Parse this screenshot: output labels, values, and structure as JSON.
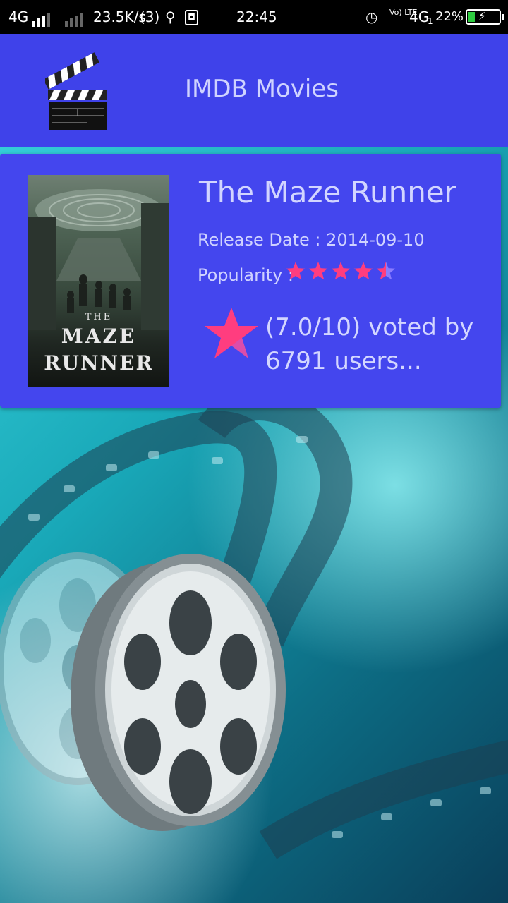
{
  "status_bar": {
    "network_left": "4G",
    "speed": "23.5K/s",
    "data_icon_text": "(3)",
    "time": "22:45",
    "volte": "Vo) LTE",
    "network_right": "4G",
    "sim_slot": "1",
    "battery": "22%"
  },
  "app": {
    "title": "IMDB Movies",
    "logo_icon": "clapperboard-icon"
  },
  "movie": {
    "title": "The Maze Runner",
    "release": "Release Date : 2014-09-10",
    "popularity_label": "Popularity :",
    "rating_stars": 4.5,
    "rating_stars_max": 5,
    "votes_text": "(7.0/10) voted by 6791 users...",
    "poster": {
      "line1": "THE",
      "line2": "MAZE",
      "line3": "RUNNER"
    }
  },
  "colors": {
    "app_bar": "#3f42ea",
    "card": "#4446ee",
    "star": "#ff3d7f"
  }
}
